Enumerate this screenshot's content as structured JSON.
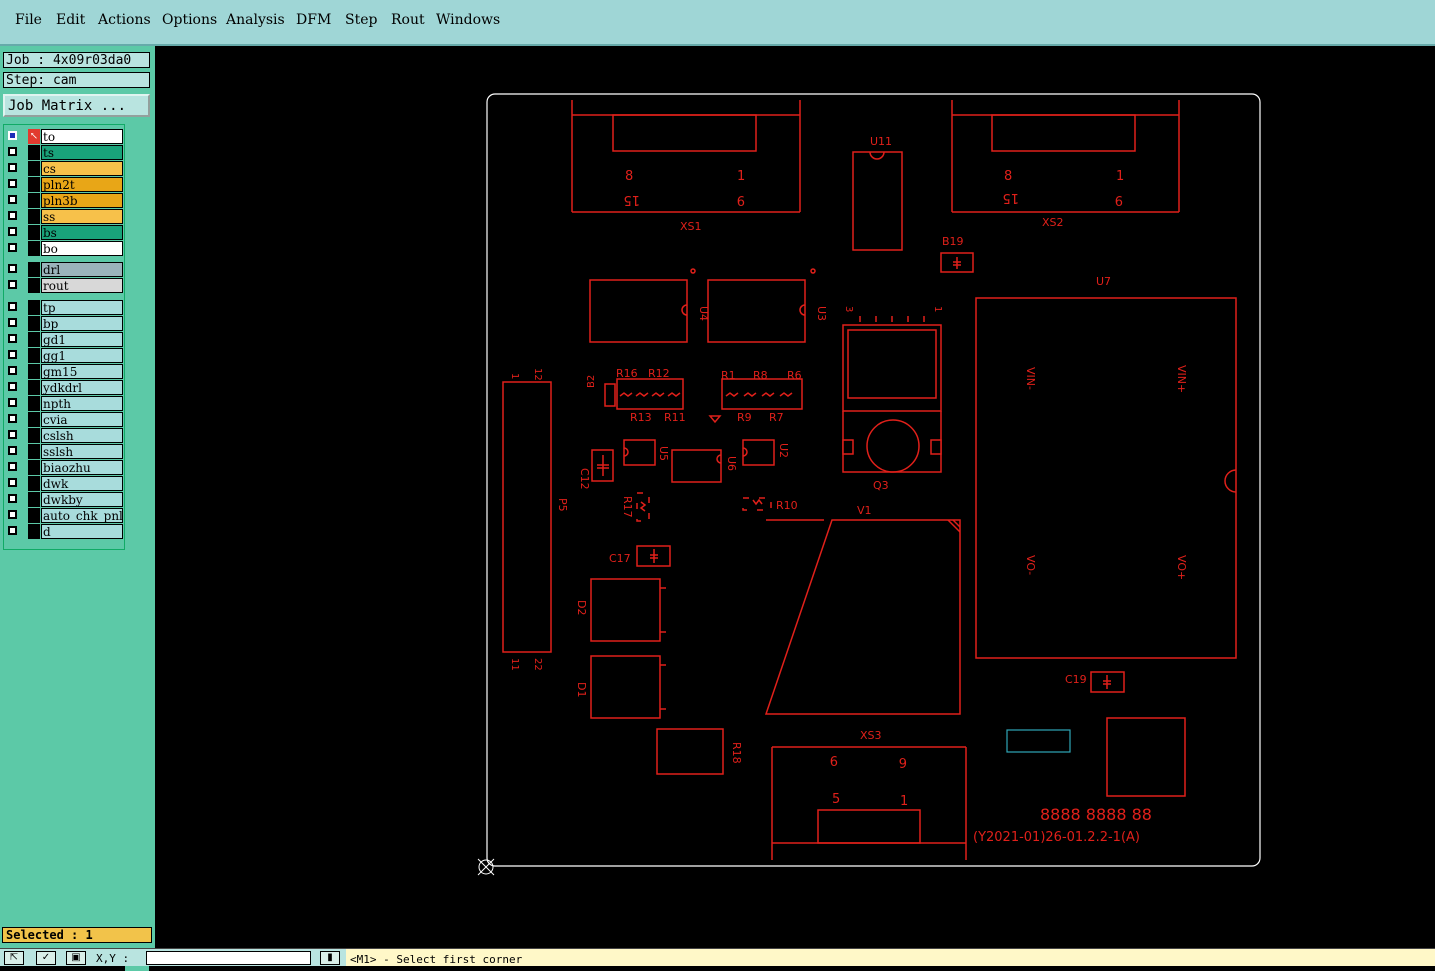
{
  "menu": {
    "items": [
      {
        "label": "File"
      },
      {
        "label": "Edit"
      },
      {
        "label": "Actions"
      },
      {
        "label": "Options"
      },
      {
        "label": "Analysis"
      },
      {
        "label": "DFM"
      },
      {
        "label": "Step"
      },
      {
        "label": "Rout"
      },
      {
        "label": "Windows"
      }
    ]
  },
  "info": {
    "job_label": "Job : 4x09r03da0",
    "step_label": "Step: cam",
    "job_matrix_button": "Job Matrix ..."
  },
  "layers": [
    {
      "name": "to",
      "color": "#ffffff"
    },
    {
      "name": "ts",
      "color": "#19a37a"
    },
    {
      "name": "cs",
      "color": "#f7c14a"
    },
    {
      "name": "pln2t",
      "color": "#e8a617"
    },
    {
      "name": "pln3b",
      "color": "#e8a617"
    },
    {
      "name": "ss",
      "color": "#f7c14a"
    },
    {
      "name": "bs",
      "color": "#19a37a"
    },
    {
      "name": "bo",
      "color": "#ffffff"
    },
    {
      "name": "drl",
      "color": "#9bb3bb"
    },
    {
      "name": "rout",
      "color": "#d8d8d8"
    },
    {
      "name": "tp",
      "color": "#a8dcdc"
    },
    {
      "name": "bp",
      "color": "#a8dcdc"
    },
    {
      "name": "gd1",
      "color": "#a8dcdc"
    },
    {
      "name": "gg1",
      "color": "#a8dcdc"
    },
    {
      "name": "gm15",
      "color": "#a8dcdc"
    },
    {
      "name": "ydkdrl",
      "color": "#a8dcdc"
    },
    {
      "name": "npth",
      "color": "#a8dcdc"
    },
    {
      "name": "cvia",
      "color": "#a8dcdc"
    },
    {
      "name": "cslsh",
      "color": "#a8dcdc"
    },
    {
      "name": "sslsh",
      "color": "#a8dcdc"
    },
    {
      "name": "biaozhu",
      "color": "#a8dcdc"
    },
    {
      "name": "dwk",
      "color": "#a8dcdc"
    },
    {
      "name": "dwkby",
      "color": "#a8dcdc"
    },
    {
      "name": "auto_chk_pnl",
      "color": "#a8dcdc"
    },
    {
      "name": "d",
      "color": "#a8dcdc"
    }
  ],
  "selection": {
    "text": "Selected : 1"
  },
  "status": {
    "xy_label": "X,Y :",
    "prompt": "<M1> - Select first corner"
  },
  "board": {
    "silk_color": "#e0201a",
    "outline_color": "#ffffff",
    "labels": {
      "xs1": "XS1",
      "xs2": "XS2",
      "xs3": "XS3",
      "u11": "U11",
      "b19": "B19",
      "u7": "U7",
      "u4": "U4",
      "u3": "U3",
      "r16": "R16",
      "r12": "R12",
      "r13": "R13",
      "r11": "R11",
      "b2": "B2",
      "r1": "R1",
      "r8": "R8",
      "r6": "R6",
      "r9": "R9",
      "r7": "R7",
      "c12": "C12",
      "u5": "U5",
      "u6": "U6",
      "u2": "U2",
      "q3": "Q3",
      "r17": "R17",
      "r10": "R10",
      "v1": "V1",
      "p5": "P5",
      "c17": "C17",
      "d2": "D2",
      "d1": "D1",
      "r18": "R18",
      "c19": "C19",
      "vin_minus": "VIN-",
      "vin_plus": "VIN+",
      "vo_minus": "VO-",
      "vo_plus": "VO+",
      "pin_8a": "8",
      "pin_1a": "1",
      "pin_15a": "15",
      "pin_9a": "9",
      "pin_8b": "8",
      "pin_1b": "1",
      "pin_15b": "15",
      "pin_9b": "9",
      "pin_9c": "9",
      "pin_6c": "6",
      "pin_5c": "5",
      "pin_1c": "1",
      "p5_1": "1",
      "p5_12": "12",
      "p5_11": "11",
      "p5_22": "22",
      "q3_pins_left": "3",
      "q3_pins_right": "1",
      "code": "8888 8888 88",
      "part_number": "(Y2021-01)26-01.2.2-1(A)"
    }
  }
}
